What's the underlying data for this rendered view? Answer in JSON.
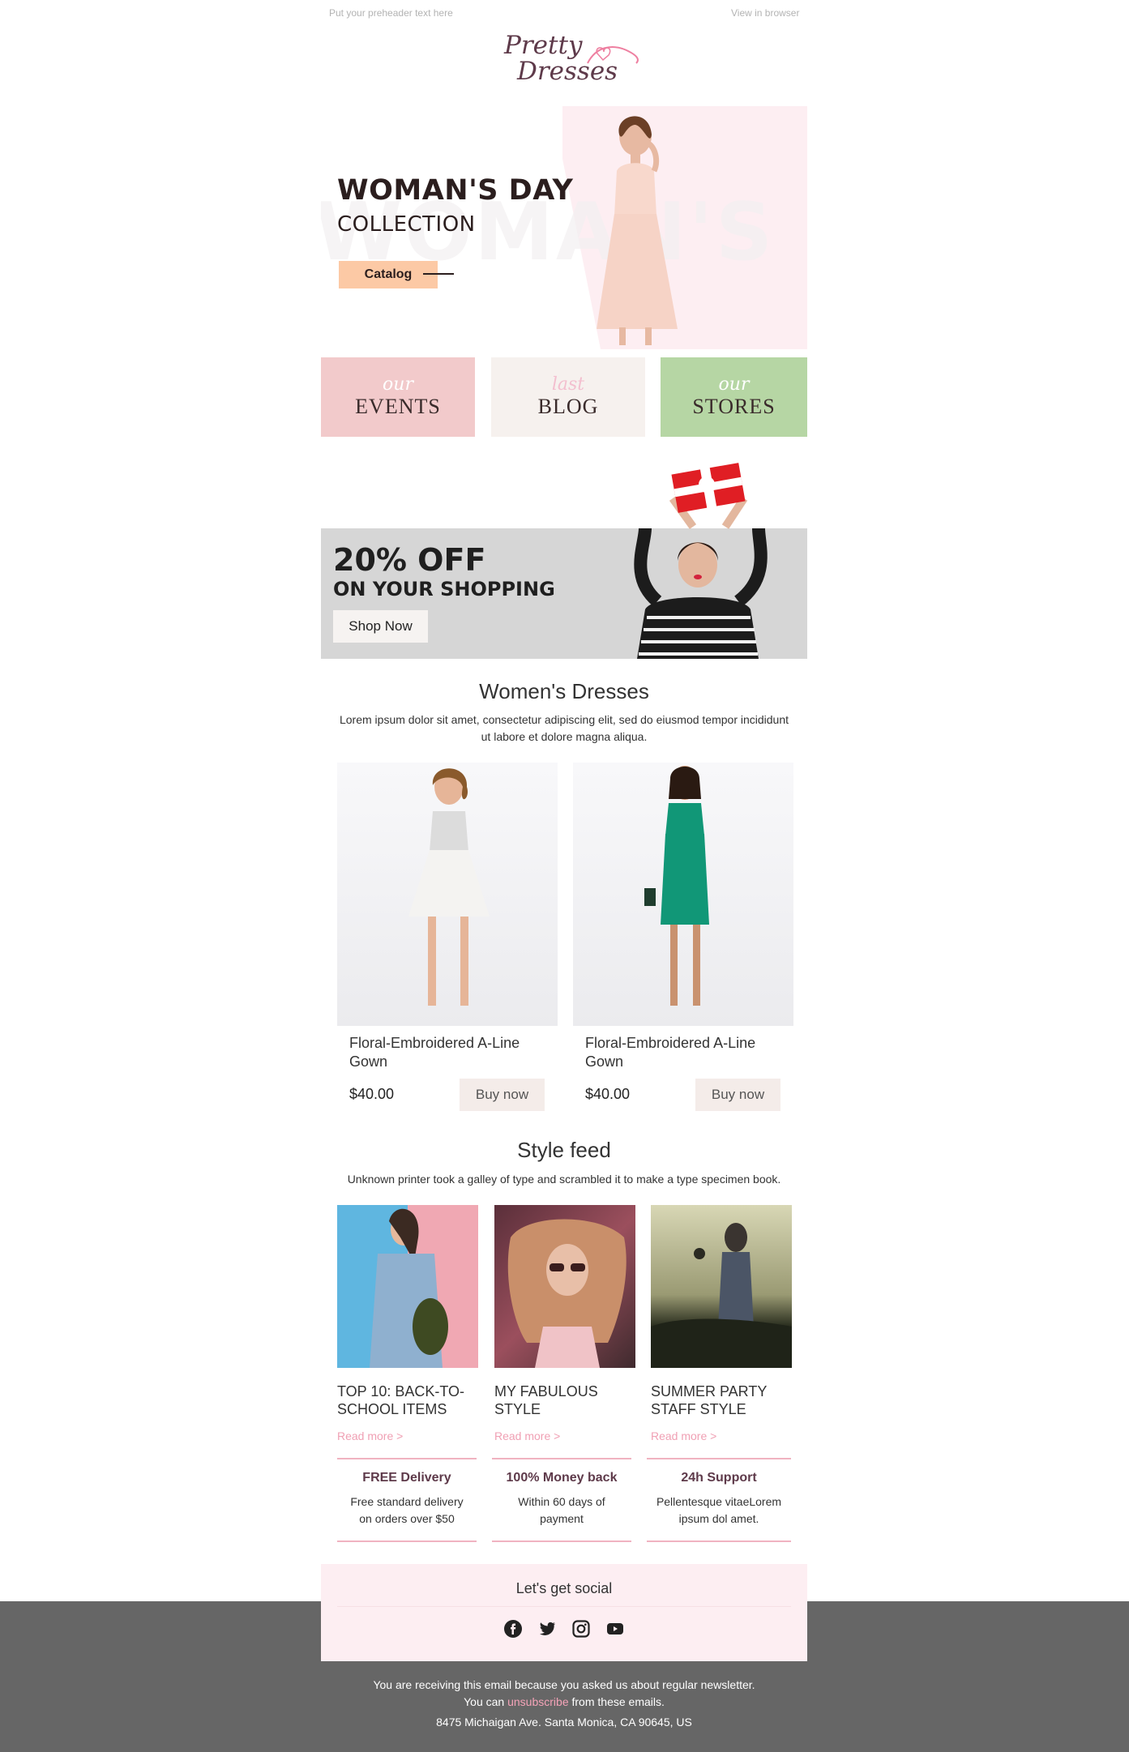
{
  "preheader": "Put your preheader text here",
  "view_in_browser": "View in browser",
  "logo": {
    "line1": "Pretty",
    "line2": "Dresses"
  },
  "hero": {
    "watermark": "WOMAN'S",
    "title": "WOMAN'S DAY",
    "subtitle": "COLLECTION",
    "cta": "Catalog"
  },
  "tiles": [
    {
      "script": "our",
      "label": "EVENTS",
      "bg": "#f2cacb",
      "script_color": "#ffffff"
    },
    {
      "script": "last",
      "label": "BLOG",
      "bg": "#f6f1ee",
      "script_color": "#f3bfcf"
    },
    {
      "script": "our",
      "label": "STORES",
      "bg": "#b6d6a4",
      "script_color": "#ffffff"
    }
  ],
  "promo": {
    "title": "20% OFF",
    "subtitle": "ON YOUR SHOPPING",
    "cta": "Shop Now"
  },
  "dresses": {
    "title": "Women's Dresses",
    "description": "Lorem ipsum dolor sit amet, consectetur adipiscing elit, sed do eiusmod tempor incididunt ut labore et dolore magna aliqua.",
    "products": [
      {
        "name": "Floral-Embroidered A-Line Gown",
        "price": "$40.00",
        "cta": "Buy now",
        "dress_color": "#f1f1ef"
      },
      {
        "name": "Floral-Embroidered A-Line Gown",
        "price": "$40.00",
        "cta": "Buy now",
        "dress_color": "#119777"
      }
    ]
  },
  "style_feed": {
    "title": "Style feed",
    "description": "Unknown printer took a galley of type and scrambled it to make a type specimen book.",
    "items": [
      {
        "title": "TOP 10: BACK-TO-SCHOOL ITEMS",
        "link": "Read more >"
      },
      {
        "title": "MY FABULOUS STYLE",
        "link": "Read more >"
      },
      {
        "title": "SUMMER PARTY STAFF STYLE",
        "link": "Read more >"
      }
    ]
  },
  "benefits": [
    {
      "title": "FREE Delivery",
      "text": "Free standard delivery on orders over $50"
    },
    {
      "title": "100% Money back",
      "text": "Within 60 days of payment"
    },
    {
      "title": "24h Support",
      "text": "Pellentesque vitaeLorem ipsum dol amet."
    }
  ],
  "social": {
    "title": "Let's get social",
    "icons": [
      "facebook-icon",
      "twitter-icon",
      "instagram-icon",
      "youtube-icon"
    ]
  },
  "footer": {
    "line1": "You are receiving this email because you asked us about regular newsletter.",
    "line2_pre": "You can ",
    "unsubscribe": "unsubscribe",
    "line2_post": " from these emails.",
    "address": "8475 Michaigan Ave. Santa Monica, CA 90645, US"
  }
}
